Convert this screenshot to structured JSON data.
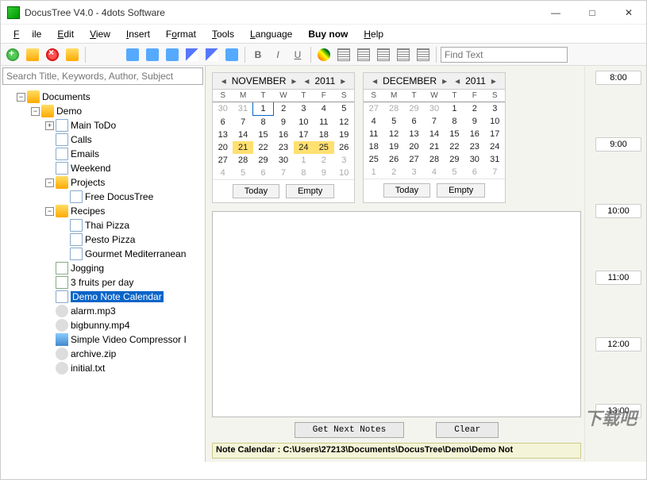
{
  "window": {
    "title": "DocusTree V4.0 - 4dots Software"
  },
  "menu": [
    "File",
    "Edit",
    "View",
    "Insert",
    "Format",
    "Tools",
    "Language",
    "Buy now",
    "Help"
  ],
  "search_placeholder": "Search Title, Keywords, Author, Subject",
  "find_placeholder": "Find Text",
  "tree": {
    "root": "Documents",
    "demo": "Demo",
    "main_todo": "Main ToDo",
    "calls": "Calls",
    "emails": "Emails",
    "weekend": "Weekend",
    "projects": "Projects",
    "free_docustree": "Free DocusTree",
    "recipes": "Recipes",
    "thai_pizza": "Thai Pizza",
    "pesto_pizza": "Pesto Pizza",
    "gourmet": "Gourmet Mediterranean",
    "jogging": "Jogging",
    "fruits": "3 fruits per day",
    "demo_note": "Demo Note Calendar",
    "alarm": "alarm.mp3",
    "bigbunny": "bigbunny.mp4",
    "compressor": "Simple Video Compressor I",
    "archive": "archive.zip",
    "initial": "initial.txt"
  },
  "cal1": {
    "month": "NOVEMBER",
    "year": "2011",
    "dow": [
      "S",
      "M",
      "T",
      "W",
      "T",
      "F",
      "S"
    ],
    "rows": [
      [
        {
          "d": "30",
          "g": 1
        },
        {
          "d": "31",
          "g": 1
        },
        {
          "d": "1",
          "t": 1
        },
        {
          "d": "2"
        },
        {
          "d": "3"
        },
        {
          "d": "4"
        },
        {
          "d": "5"
        }
      ],
      [
        {
          "d": "6"
        },
        {
          "d": "7"
        },
        {
          "d": "8"
        },
        {
          "d": "9"
        },
        {
          "d": "10"
        },
        {
          "d": "11"
        },
        {
          "d": "12"
        }
      ],
      [
        {
          "d": "13"
        },
        {
          "d": "14"
        },
        {
          "d": "15"
        },
        {
          "d": "16"
        },
        {
          "d": "17"
        },
        {
          "d": "18"
        },
        {
          "d": "19"
        }
      ],
      [
        {
          "d": "20"
        },
        {
          "d": "21",
          "h": 1
        },
        {
          "d": "22"
        },
        {
          "d": "23"
        },
        {
          "d": "24",
          "h": 1
        },
        {
          "d": "25",
          "h": 1
        },
        {
          "d": "26"
        }
      ],
      [
        {
          "d": "27"
        },
        {
          "d": "28"
        },
        {
          "d": "29"
        },
        {
          "d": "30"
        },
        {
          "d": "1",
          "g": 1
        },
        {
          "d": "2",
          "g": 1
        },
        {
          "d": "3",
          "g": 1
        }
      ],
      [
        {
          "d": "4",
          "g": 1
        },
        {
          "d": "5",
          "g": 1
        },
        {
          "d": "6",
          "g": 1
        },
        {
          "d": "7",
          "g": 1
        },
        {
          "d": "8",
          "g": 1
        },
        {
          "d": "9",
          "g": 1
        },
        {
          "d": "10",
          "g": 1
        }
      ]
    ],
    "today_btn": "Today",
    "empty_btn": "Empty"
  },
  "cal2": {
    "month": "DECEMBER",
    "year": "2011",
    "dow": [
      "S",
      "M",
      "T",
      "W",
      "T",
      "F",
      "S"
    ],
    "rows": [
      [
        {
          "d": "27",
          "g": 1
        },
        {
          "d": "28",
          "g": 1
        },
        {
          "d": "29",
          "g": 1
        },
        {
          "d": "30",
          "g": 1
        },
        {
          "d": "1"
        },
        {
          "d": "2"
        },
        {
          "d": "3"
        }
      ],
      [
        {
          "d": "4"
        },
        {
          "d": "5"
        },
        {
          "d": "6"
        },
        {
          "d": "7"
        },
        {
          "d": "8"
        },
        {
          "d": "9"
        },
        {
          "d": "10"
        }
      ],
      [
        {
          "d": "11"
        },
        {
          "d": "12"
        },
        {
          "d": "13"
        },
        {
          "d": "14"
        },
        {
          "d": "15"
        },
        {
          "d": "16"
        },
        {
          "d": "17"
        }
      ],
      [
        {
          "d": "18"
        },
        {
          "d": "19"
        },
        {
          "d": "20"
        },
        {
          "d": "21"
        },
        {
          "d": "22"
        },
        {
          "d": "23"
        },
        {
          "d": "24"
        }
      ],
      [
        {
          "d": "25"
        },
        {
          "d": "26"
        },
        {
          "d": "27"
        },
        {
          "d": "28"
        },
        {
          "d": "29"
        },
        {
          "d": "30"
        },
        {
          "d": "31"
        }
      ],
      [
        {
          "d": "1",
          "g": 1
        },
        {
          "d": "2",
          "g": 1
        },
        {
          "d": "3",
          "g": 1
        },
        {
          "d": "4",
          "g": 1
        },
        {
          "d": "5",
          "g": 1
        },
        {
          "d": "6",
          "g": 1
        },
        {
          "d": "7",
          "g": 1
        }
      ]
    ],
    "today_btn": "Today",
    "empty_btn": "Empty"
  },
  "bottom": {
    "get_next": "Get Next Notes",
    "clear": "Clear"
  },
  "status": "Note Calendar : C:\\Users\\27213\\Documents\\DocusTree\\Demo\\Demo Not",
  "times": [
    "8:00",
    "9:00",
    "10:00",
    "11:00",
    "12:00",
    "13:00"
  ],
  "watermark": "下载吧"
}
